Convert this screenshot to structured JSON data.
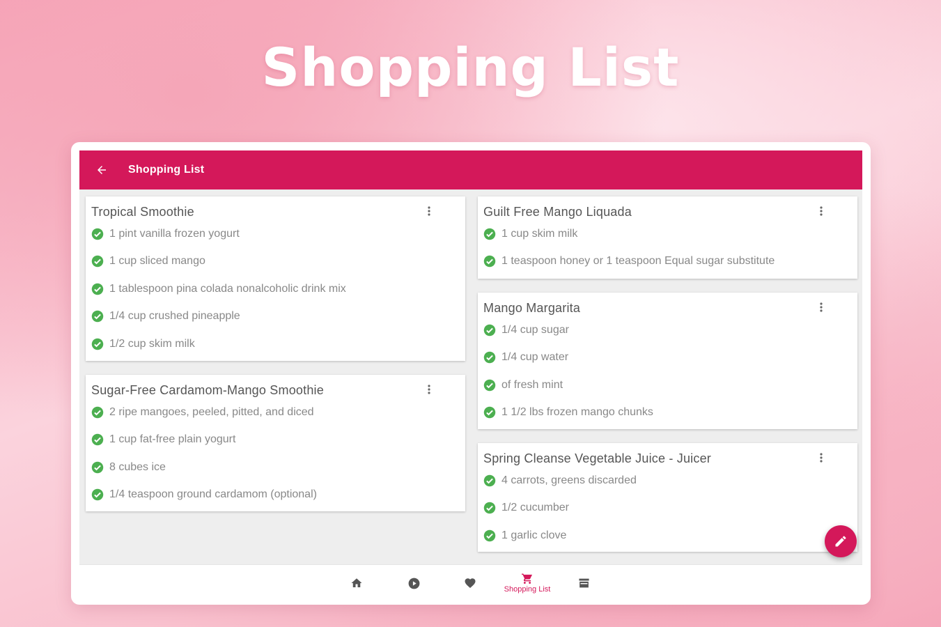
{
  "hero": {
    "title": "Shopping List"
  },
  "appbar": {
    "title": "Shopping List",
    "back_icon": "arrow-left-icon"
  },
  "colors": {
    "accent": "#d4185a",
    "check": "#4caf50",
    "card_bg": "#ffffff",
    "content_bg": "#eeeeee"
  },
  "cards": [
    {
      "title": "Tropical Smoothie",
      "items": [
        "1 pint vanilla frozen yogurt",
        "1 cup sliced mango",
        "1 tablespoon pina colada nonalcoholic drink mix",
        "1/4 cup crushed pineapple",
        "1/2 cup skim milk"
      ]
    },
    {
      "title": "Sugar-Free Cardamom-Mango Smoothie",
      "items": [
        "2 ripe mangoes, peeled, pitted, and diced",
        "1 cup fat-free plain yogurt",
        "8 cubes ice",
        "1/4 teaspoon ground cardamom (optional)"
      ]
    },
    {
      "title": "Guilt Free Mango Liquada",
      "items": [
        "1 cup skim milk",
        "1 teaspoon honey or 1 teaspoon Equal sugar substitute"
      ]
    },
    {
      "title": "Mango Margarita",
      "items": [
        "1/4 cup sugar",
        "1/4 cup water",
        "of fresh mint",
        "1 1/2 lbs frozen mango chunks"
      ]
    },
    {
      "title": "Spring Cleanse Vegetable Juice - Juicer",
      "items": [
        "4 carrots, greens discarded",
        "1/2 cucumber",
        "1 garlic clove"
      ]
    }
  ],
  "fab": {
    "icon": "pencil-icon"
  },
  "bottom_nav": {
    "items": [
      {
        "icon": "home-icon",
        "label": ""
      },
      {
        "icon": "play-icon",
        "label": ""
      },
      {
        "icon": "heart-icon",
        "label": ""
      },
      {
        "icon": "cart-icon",
        "label": "Shopping List",
        "active": true
      },
      {
        "icon": "store-icon",
        "label": ""
      }
    ]
  }
}
